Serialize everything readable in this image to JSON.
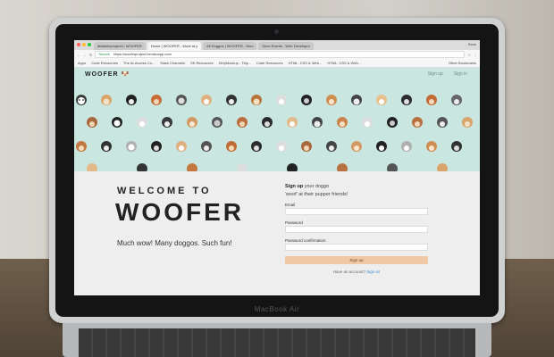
{
  "browser": {
    "tabs": [
      {
        "label": "dfafahle/project1: WOOFER",
        "active": false
      },
      {
        "label": "Home | WOOFER - Woof at y",
        "active": true
      },
      {
        "label": "All Doggos | WOOFER - Woo",
        "active": false
      },
      {
        "label": "Skon Events - Web Developm",
        "active": false
      }
    ],
    "user": "Sean",
    "address": {
      "secure_label": "Secure",
      "url": "https://wooferproject.herokuapp.com"
    },
    "bookmarks": [
      "Apps",
      "Code Resources",
      "The AI-Access Co...",
      "Slack Channels",
      "SK Resources",
      "DirtyMockup - Tidy...",
      "Code Resources",
      "HTML, CSS & Web...",
      "HTML, CSS & Web..."
    ],
    "other_bookmarks": "Other Bookmarks"
  },
  "site": {
    "logo": "WOOFER",
    "nav": {
      "signup": "Sign up",
      "signin": "Sign in"
    },
    "hero_bg": "#c9e7e0",
    "welcome": "WELCOME TO",
    "title": "WOOFER",
    "tagline": "Much wow! Many doggos. Such fun!",
    "form": {
      "heading_bold": "Sign up",
      "heading_rest": " your doggo",
      "subheading": "'woof' at their pupper friends!",
      "email_label": "Email",
      "password_label": "Password",
      "confirm_label": "Password confirmation",
      "button": "Sign up",
      "account_prompt": "Have an account?",
      "signin_link": "Sign in!",
      "button_color": "#f0c9a4"
    }
  },
  "device": {
    "brand": "MacBook Air"
  }
}
